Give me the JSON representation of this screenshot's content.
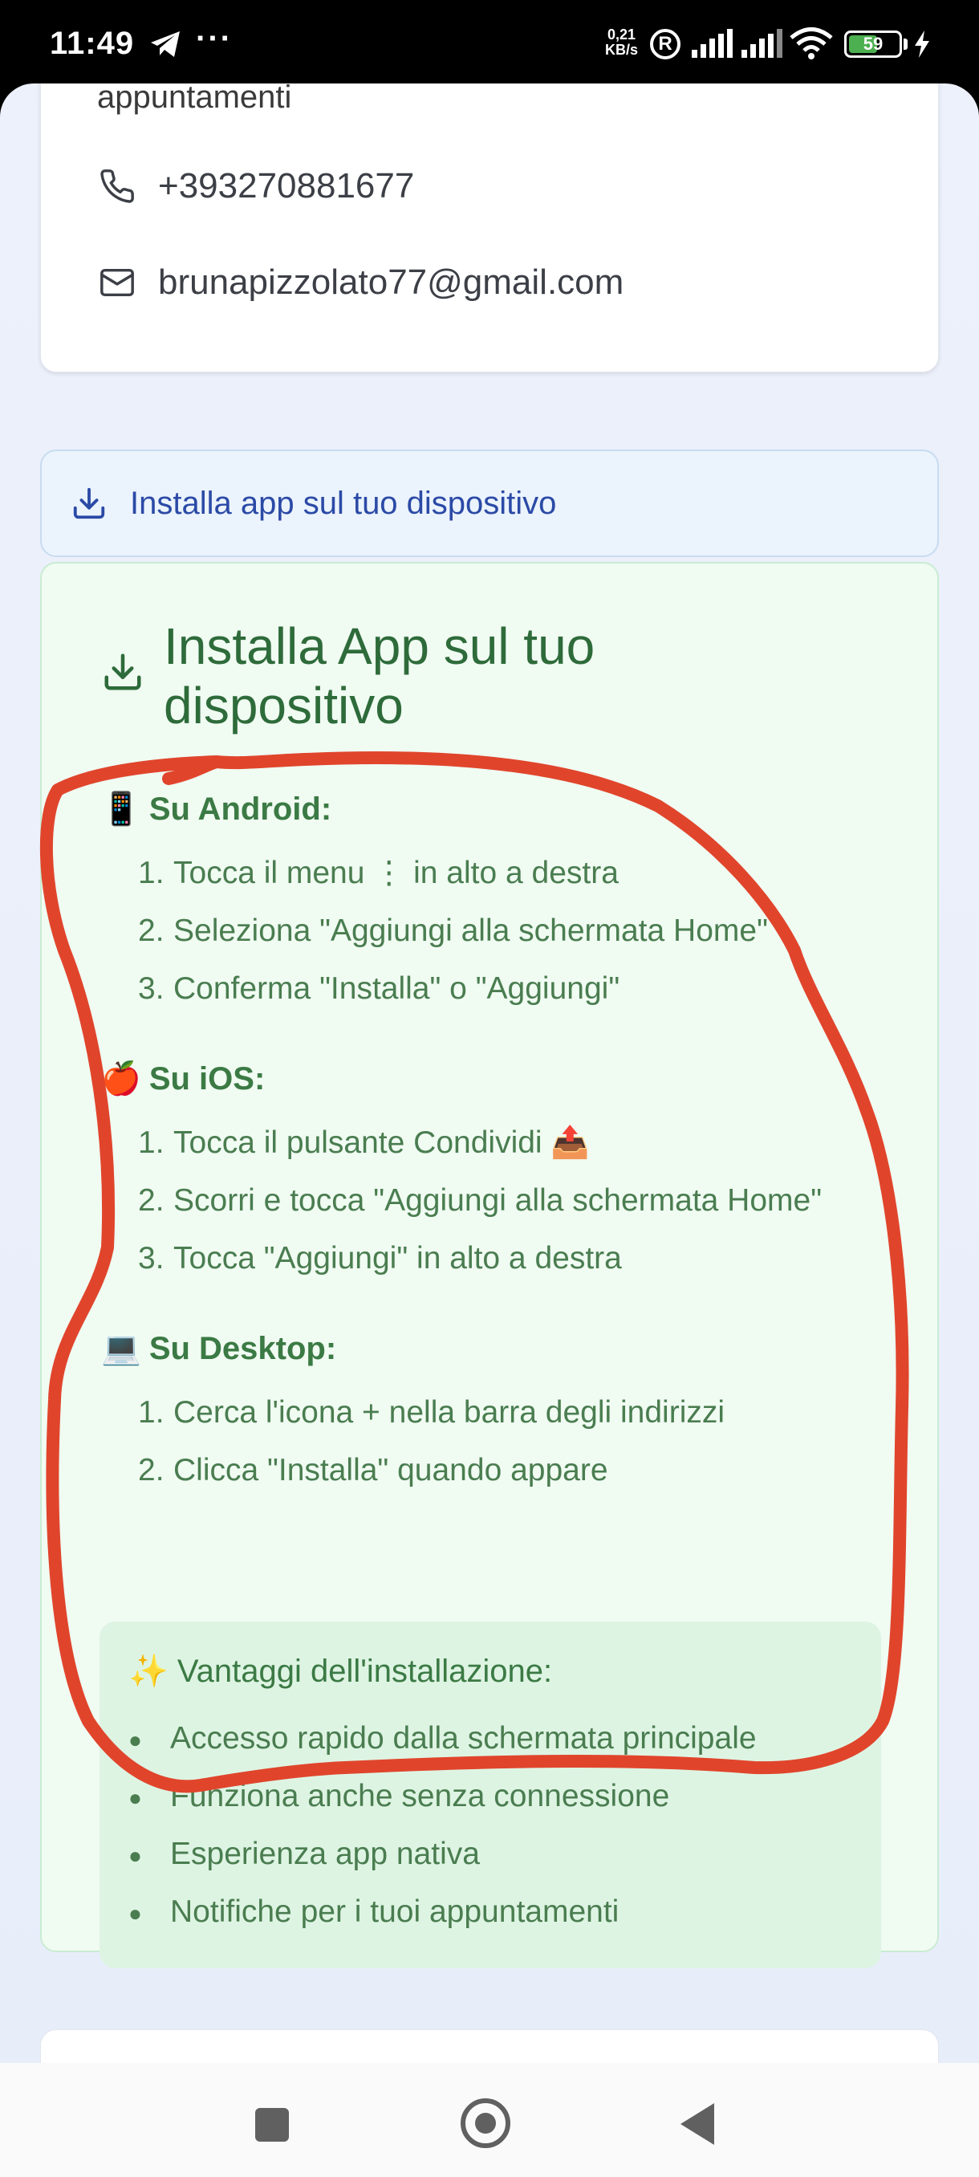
{
  "status_bar": {
    "time": "11:49",
    "overflow_dots": "···",
    "net_speed_value": "0,21",
    "net_speed_unit": "KB/s",
    "registered_mark": "R",
    "battery_level": 59,
    "battery_text": "59",
    "charging": true
  },
  "contact": {
    "cut_text": "appuntamenti",
    "phone": "+393270881677",
    "email": "brunapizzolato77@gmail.com"
  },
  "install_bar": {
    "label": "Installa app sul tuo dispositivo"
  },
  "install_panel": {
    "title": "Installa App sul tuo dispositivo",
    "sections": [
      {
        "emoji": "📱",
        "heading": "Su Android:",
        "steps": [
          "Tocca il menu ⋮ in alto a destra",
          "Seleziona \"Aggiungi alla schermata Home\"",
          "Conferma \"Installa\" o \"Aggiungi\""
        ]
      },
      {
        "emoji": "🍎",
        "heading": "Su iOS:",
        "steps": [
          "Tocca il pulsante Condividi 📤",
          "Scorri e tocca \"Aggiungi alla schermata Home\"",
          "Tocca \"Aggiungi\" in alto a destra"
        ]
      },
      {
        "emoji": "💻",
        "heading": "Su Desktop:",
        "steps": [
          "Cerca l'icona + nella barra degli indirizzi",
          "Clicca \"Installa\" quando appare"
        ]
      }
    ],
    "benefits": {
      "title": "✨ Vantaggi dell'installazione:",
      "items": [
        "Accesso rapido dalla schermata principale",
        "Funziona anche senza connessione",
        "Esperienza app nativa",
        "Notifiche per i tuoi appuntamenti"
      ]
    }
  },
  "annotation": {
    "color": "#e0452c"
  },
  "colors": {
    "page_bg": "#edf1fb",
    "panel_bg": "#f0fbf2",
    "panel_text": "#2e6b3a",
    "install_bar_text": "#2b4aa6"
  }
}
